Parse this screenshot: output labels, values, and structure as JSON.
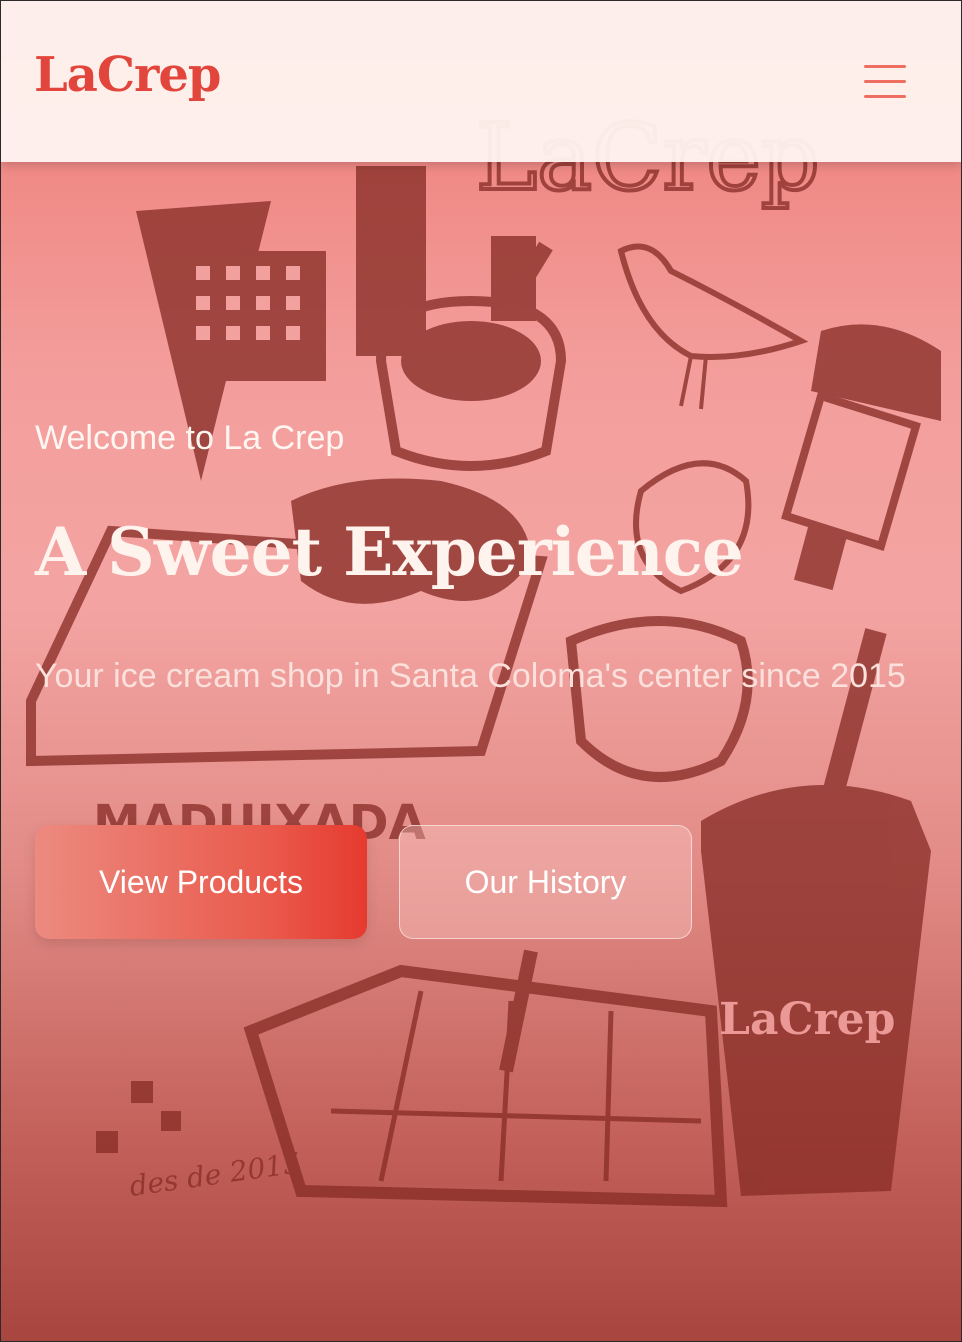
{
  "header": {
    "logo_text": "LaCrep",
    "menu_icon": "hamburger-menu-icon"
  },
  "hero": {
    "welcome": "Welcome to La Crep",
    "headline": "A Sweet Experience",
    "tagline": "Your ice cream shop in Santa Coloma's center since 2015",
    "buttons": {
      "primary_label": "View Products",
      "secondary_label": "Our History"
    }
  },
  "background_illustration": {
    "texts": [
      "LaCrep",
      "MADUIXADA",
      "des de 2015",
      "LaCrep"
    ]
  },
  "colors": {
    "brand_red": "#e2453b",
    "hero_overlay": "#f09a96",
    "illustration_ink": "#8a2e28"
  }
}
